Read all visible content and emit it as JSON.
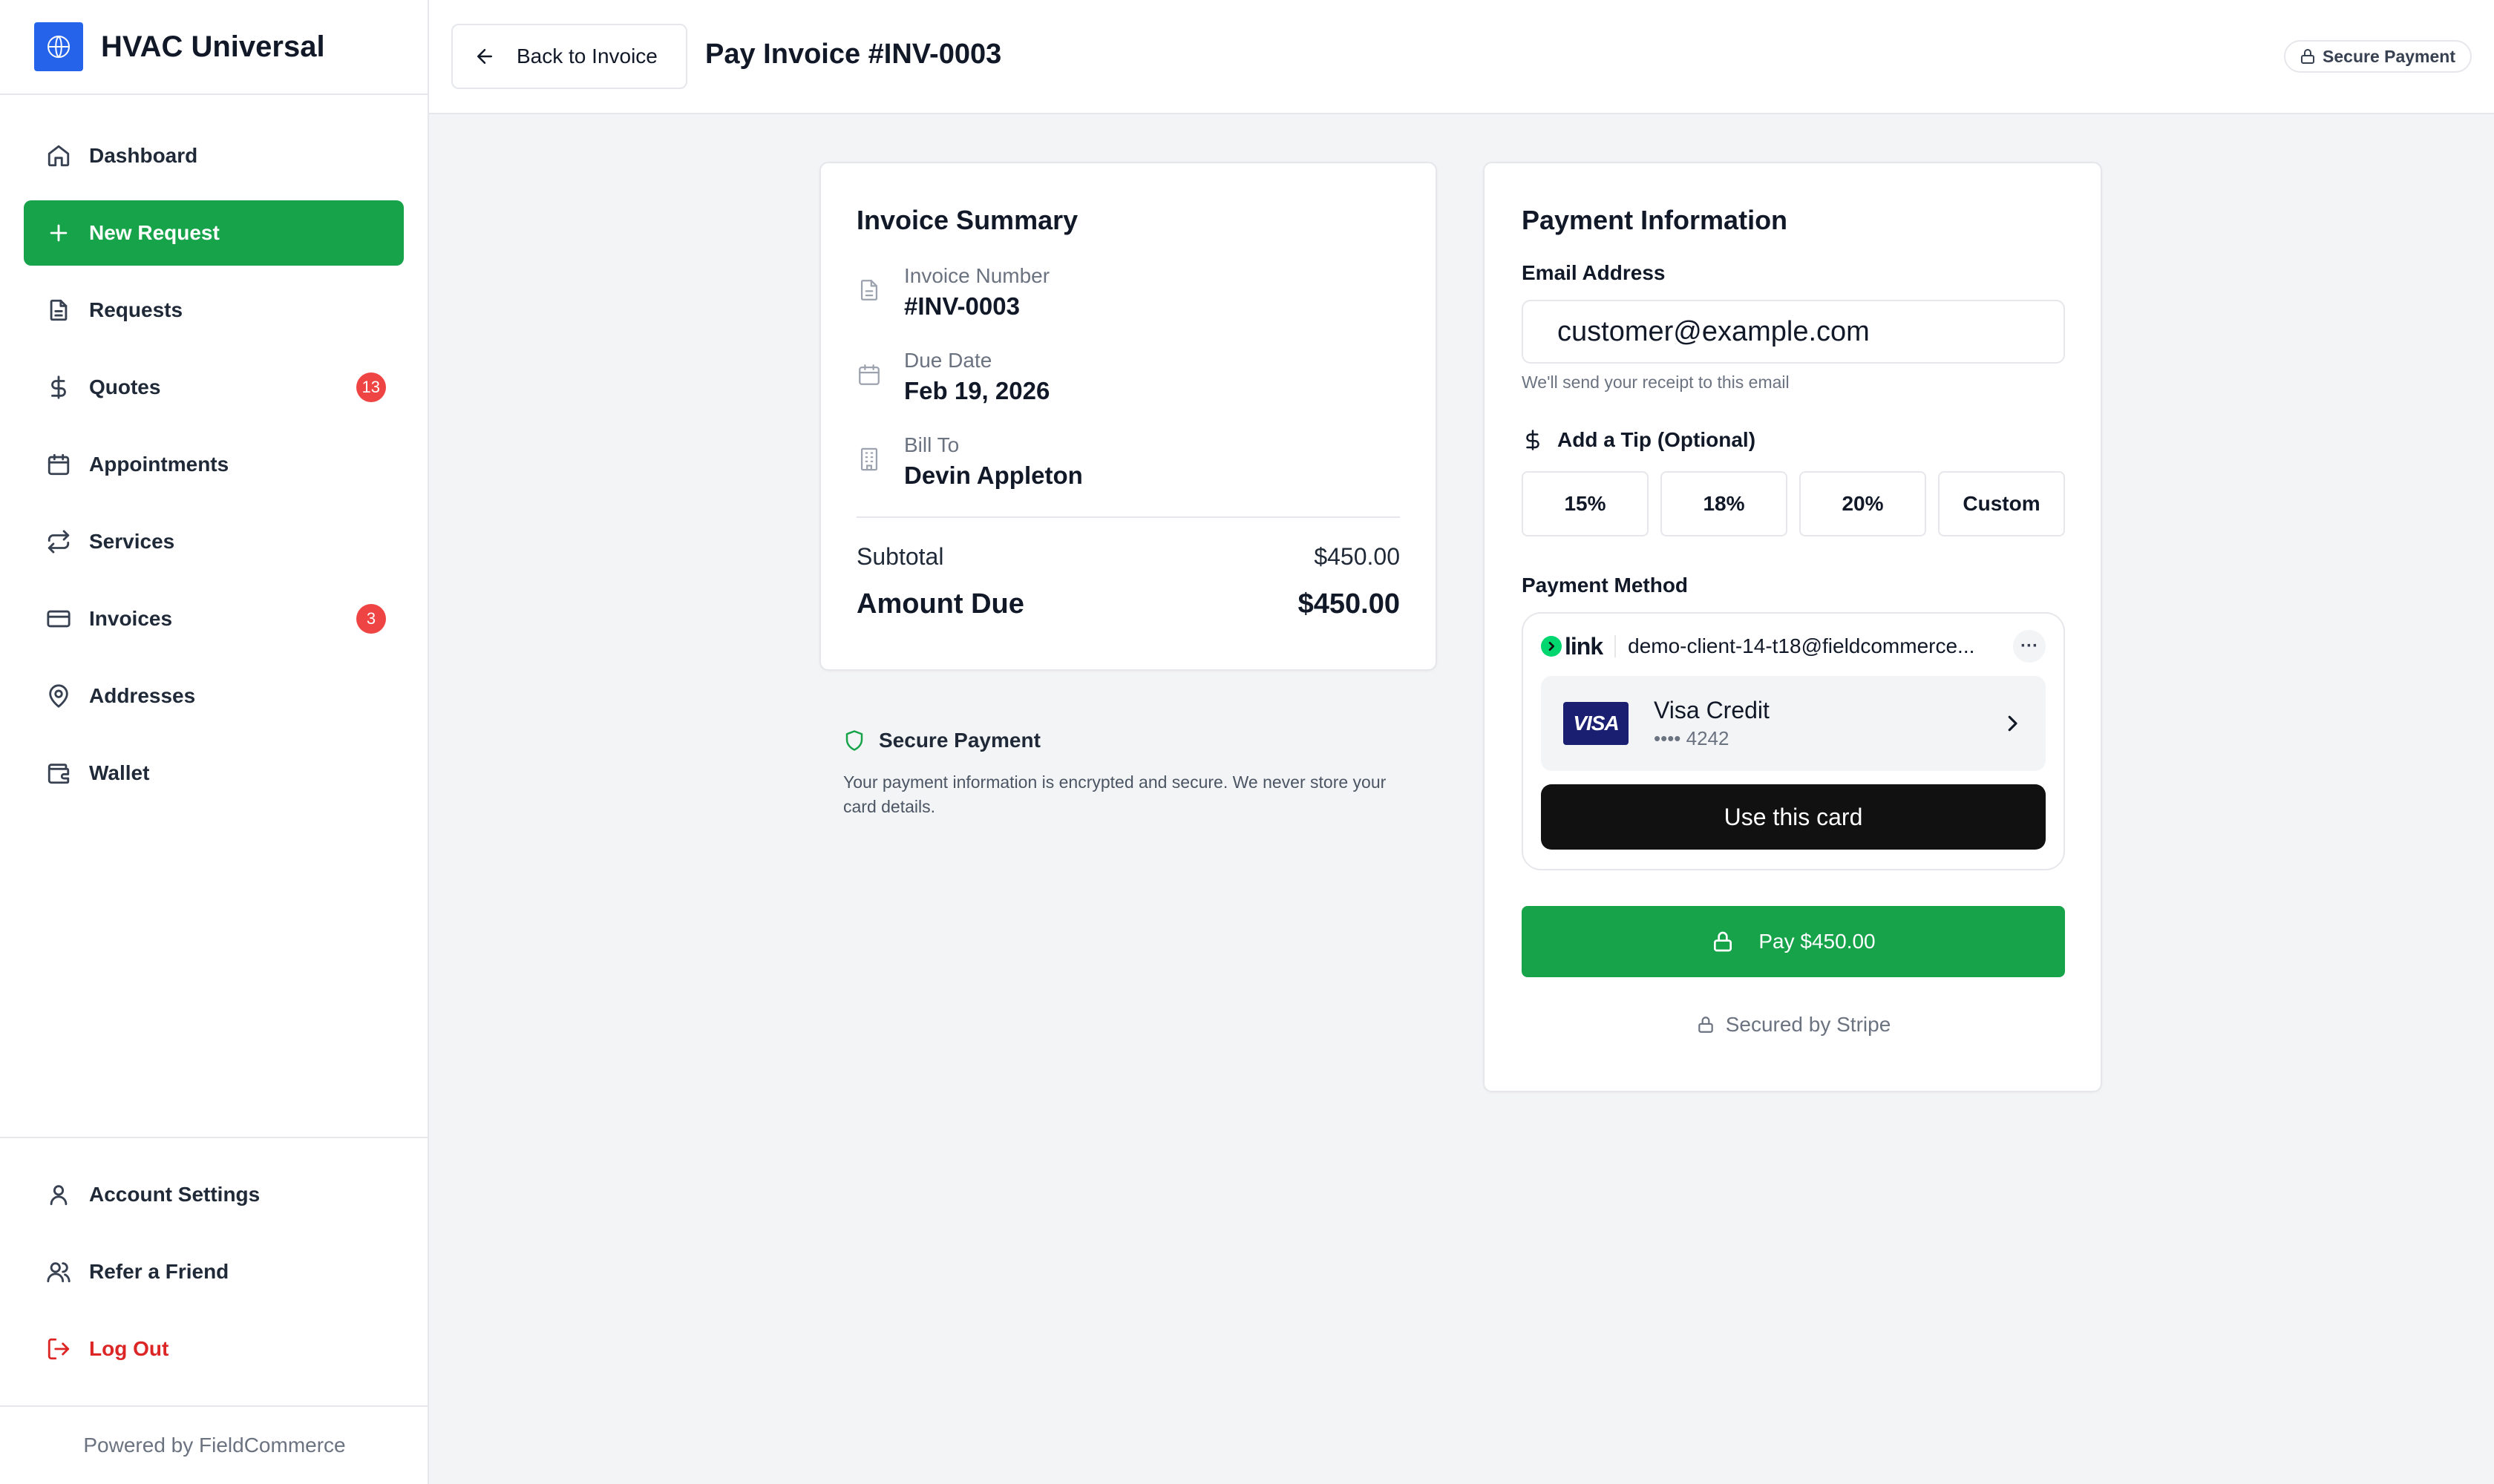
{
  "brand": {
    "name": "HVAC Universal"
  },
  "sidebar": {
    "items": [
      {
        "label": "Dashboard",
        "icon": "home-icon"
      },
      {
        "label": "New Request",
        "icon": "plus-icon"
      },
      {
        "label": "Requests",
        "icon": "document-icon"
      },
      {
        "label": "Quotes",
        "icon": "dollar-icon",
        "badge": "13"
      },
      {
        "label": "Appointments",
        "icon": "calendar-icon"
      },
      {
        "label": "Services",
        "icon": "arrows-swap-icon"
      },
      {
        "label": "Invoices",
        "icon": "credit-card-icon",
        "badge": "3"
      },
      {
        "label": "Addresses",
        "icon": "map-pin-icon"
      },
      {
        "label": "Wallet",
        "icon": "wallet-icon"
      }
    ],
    "bottom": [
      {
        "label": "Account Settings",
        "icon": "user-icon"
      },
      {
        "label": "Refer a Friend",
        "icon": "users-icon"
      },
      {
        "label": "Log Out",
        "icon": "logout-icon"
      }
    ],
    "powered_by": "Powered by FieldCommerce"
  },
  "header": {
    "back_label": "Back to Invoice",
    "title": "Pay Invoice #INV-0003",
    "secure_label": "Secure Payment"
  },
  "summary": {
    "title": "Invoice Summary",
    "invoice_number_label": "Invoice Number",
    "invoice_number": "#INV-0003",
    "due_date_label": "Due Date",
    "due_date": "Feb 19, 2026",
    "bill_to_label": "Bill To",
    "bill_to": "Devin Appleton",
    "subtotal_label": "Subtotal",
    "subtotal": "$450.00",
    "amount_due_label": "Amount Due",
    "amount_due": "$450.00"
  },
  "secure_note": {
    "title": "Secure Payment",
    "text": "Your payment information is encrypted and secure. We never store your card details."
  },
  "payment": {
    "title": "Payment Information",
    "email_label": "Email Address",
    "email_value": "customer@example.com",
    "email_hint": "We'll send your receipt to this email",
    "tip_label": "Add a Tip (Optional)",
    "tips": [
      "15%",
      "18%",
      "20%",
      "Custom"
    ],
    "method_label": "Payment Method",
    "link_logo": "link",
    "link_email": "demo-client-14-t18@fieldcommerce...",
    "more": "···",
    "card_brand": "VISA",
    "card_name": "Visa Credit",
    "card_number": "•••• 4242",
    "use_card_label": "Use this card",
    "pay_label": "Pay $450.00",
    "secured_by": "Secured by Stripe"
  },
  "colors": {
    "accent": "#16a34a",
    "danger": "#ef4444",
    "brand_blue": "#2563eb",
    "visa": "#1a1f71",
    "link_green": "#00d66f"
  }
}
